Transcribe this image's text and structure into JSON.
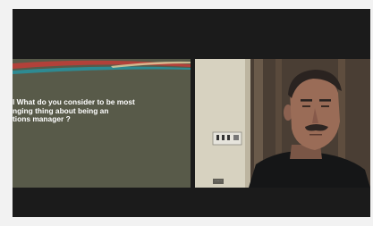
{
  "shared_slide": {
    "question_lines": "l What do you consider to be most\nnging  thing about being an\ntions manager ?"
  },
  "participant": {
    "name_label": "······"
  },
  "colors": {
    "frame_bg": "#1b1b1b",
    "slide_bg": "#585a49",
    "slide_banner_red": "#b2413a",
    "slide_banner_teal": "#2e8a92",
    "slide_text": "#ffffff",
    "wall": "#d7d2c0",
    "curtain": "#6a5a4a"
  }
}
